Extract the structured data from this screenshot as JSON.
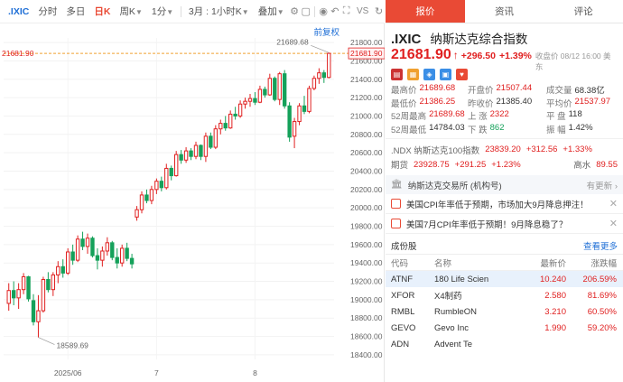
{
  "toolbar": {
    "code": ".IXIC",
    "items": [
      "分时",
      "多日",
      "日K",
      "周K",
      "1分",
      "3月",
      "1小时K",
      "叠加"
    ],
    "vs": "VS"
  },
  "chart": {
    "restore_label": "前复权",
    "current_price_label": "21681.90",
    "high_label": "21689.68",
    "low_label": "18589.69",
    "colors": {
      "up": "#e02020",
      "down": "#15a15a",
      "price_line": "#f0a030"
    }
  },
  "chart_data": {
    "type": "candlestick",
    "x_labels": [
      "2025/06",
      "7",
      "8"
    ],
    "y_ticks": [
      21800,
      21600,
      21400,
      21200,
      21000,
      20800,
      20600,
      20400,
      20200,
      20000,
      19800,
      19600,
      19400,
      19200,
      19000,
      18800,
      18600,
      18400
    ],
    "ylim": [
      18350,
      21850
    ],
    "candles": [
      {
        "o": 18960,
        "h": 19180,
        "l": 18880,
        "c": 19100
      },
      {
        "o": 19100,
        "h": 19200,
        "l": 18940,
        "c": 19020
      },
      {
        "o": 19020,
        "h": 19180,
        "l": 18900,
        "c": 19110
      },
      {
        "o": 19110,
        "h": 19290,
        "l": 19060,
        "c": 19250
      },
      {
        "o": 19250,
        "h": 19260,
        "l": 18980,
        "c": 19010
      },
      {
        "o": 18990,
        "h": 19060,
        "l": 18720,
        "c": 18760
      },
      {
        "o": 18760,
        "h": 19050,
        "l": 18590,
        "c": 18880
      },
      {
        "o": 18880,
        "h": 19250,
        "l": 18860,
        "c": 19220
      },
      {
        "o": 19220,
        "h": 19300,
        "l": 19080,
        "c": 19110
      },
      {
        "o": 19110,
        "h": 19300,
        "l": 19040,
        "c": 19270
      },
      {
        "o": 19270,
        "h": 19420,
        "l": 19180,
        "c": 19360
      },
      {
        "o": 19360,
        "h": 19440,
        "l": 19240,
        "c": 19290
      },
      {
        "o": 19290,
        "h": 19560,
        "l": 19270,
        "c": 19520
      },
      {
        "o": 19520,
        "h": 19600,
        "l": 19380,
        "c": 19430
      },
      {
        "o": 19430,
        "h": 19700,
        "l": 19410,
        "c": 19660
      },
      {
        "o": 19660,
        "h": 19740,
        "l": 19540,
        "c": 19580
      },
      {
        "o": 19580,
        "h": 19720,
        "l": 19500,
        "c": 19670
      },
      {
        "o": 19670,
        "h": 19690,
        "l": 19460,
        "c": 19480
      },
      {
        "o": 19480,
        "h": 19560,
        "l": 19330,
        "c": 19430
      },
      {
        "o": 19430,
        "h": 19580,
        "l": 19360,
        "c": 19530
      },
      {
        "o": 19530,
        "h": 19680,
        "l": 19480,
        "c": 19620
      },
      {
        "o": 19620,
        "h": 19640,
        "l": 19430,
        "c": 19460
      },
      {
        "o": 19460,
        "h": 19560,
        "l": 19340,
        "c": 19400
      },
      {
        "o": 19400,
        "h": 19600,
        "l": 19360,
        "c": 19560
      },
      {
        "o": 19560,
        "h": 19620,
        "l": 19420,
        "c": 19450
      },
      {
        "o": 19450,
        "h": 19500,
        "l": 19340,
        "c": 19390
      },
      {
        "o": 19900,
        "h": 20020,
        "l": 19860,
        "c": 19980
      },
      {
        "o": 19980,
        "h": 20180,
        "l": 19940,
        "c": 20140
      },
      {
        "o": 20140,
        "h": 20200,
        "l": 20050,
        "c": 20080
      },
      {
        "o": 20080,
        "h": 20240,
        "l": 20040,
        "c": 20200
      },
      {
        "o": 20200,
        "h": 20320,
        "l": 20150,
        "c": 20290
      },
      {
        "o": 20290,
        "h": 20340,
        "l": 20180,
        "c": 20220
      },
      {
        "o": 20220,
        "h": 20480,
        "l": 20200,
        "c": 20430
      },
      {
        "o": 20430,
        "h": 20460,
        "l": 20300,
        "c": 20350
      },
      {
        "o": 20350,
        "h": 20620,
        "l": 20340,
        "c": 20580
      },
      {
        "o": 20580,
        "h": 20630,
        "l": 20480,
        "c": 20520
      },
      {
        "o": 20520,
        "h": 20660,
        "l": 20490,
        "c": 20620
      },
      {
        "o": 20620,
        "h": 20650,
        "l": 20520,
        "c": 20560
      },
      {
        "o": 20560,
        "h": 20720,
        "l": 20530,
        "c": 20680
      },
      {
        "o": 20680,
        "h": 20690,
        "l": 20520,
        "c": 20560
      },
      {
        "o": 20560,
        "h": 20820,
        "l": 20500,
        "c": 20780
      },
      {
        "o": 20780,
        "h": 20820,
        "l": 20640,
        "c": 20660
      },
      {
        "o": 20660,
        "h": 20900,
        "l": 20640,
        "c": 20860
      },
      {
        "o": 20860,
        "h": 20960,
        "l": 20800,
        "c": 20920
      },
      {
        "o": 20920,
        "h": 21000,
        "l": 20840,
        "c": 20870
      },
      {
        "o": 20870,
        "h": 21060,
        "l": 20860,
        "c": 21020
      },
      {
        "o": 21020,
        "h": 21100,
        "l": 20960,
        "c": 21000
      },
      {
        "o": 21000,
        "h": 21170,
        "l": 20980,
        "c": 21130
      },
      {
        "o": 21130,
        "h": 21200,
        "l": 21080,
        "c": 21160
      },
      {
        "o": 21160,
        "h": 21240,
        "l": 21100,
        "c": 21190
      },
      {
        "o": 21190,
        "h": 21260,
        "l": 21120,
        "c": 21150
      },
      {
        "o": 21150,
        "h": 21330,
        "l": 21140,
        "c": 21290
      },
      {
        "o": 21290,
        "h": 21320,
        "l": 21200,
        "c": 21230
      },
      {
        "o": 21230,
        "h": 21460,
        "l": 21220,
        "c": 21410
      },
      {
        "o": 21410,
        "h": 21430,
        "l": 21160,
        "c": 21180
      },
      {
        "o": 21180,
        "h": 21480,
        "l": 21120,
        "c": 21460
      },
      {
        "o": 21460,
        "h": 21500,
        "l": 21080,
        "c": 21110
      },
      {
        "o": 21110,
        "h": 21150,
        "l": 20720,
        "c": 20770
      },
      {
        "o": 20780,
        "h": 20980,
        "l": 20650,
        "c": 20940
      },
      {
        "o": 20940,
        "h": 21140,
        "l": 20900,
        "c": 21110
      },
      {
        "o": 21110,
        "h": 21220,
        "l": 21020,
        "c": 21050
      },
      {
        "o": 21050,
        "h": 21330,
        "l": 21030,
        "c": 21300
      },
      {
        "o": 21300,
        "h": 21440,
        "l": 21280,
        "c": 21410
      },
      {
        "o": 21410,
        "h": 21520,
        "l": 21350,
        "c": 21470
      },
      {
        "o": 21470,
        "h": 21500,
        "l": 21360,
        "c": 21420
      },
      {
        "o": 21420,
        "h": 21689.68,
        "l": 21410,
        "c": 21681.9
      }
    ]
  },
  "right": {
    "tabs": [
      "报价",
      "资讯",
      "评论"
    ],
    "ticker": ".IXIC",
    "name": "纳斯达克综合指数",
    "price": "21681.90",
    "change": "+296.50",
    "change_pct": "+1.39%",
    "stamp": "收盘价 08/12 16:00 美东",
    "stats": [
      [
        {
          "l": "最高价",
          "v": "21689.68",
          "c": "red"
        },
        {
          "l": "开盘价",
          "v": "21507.44",
          "c": "red"
        },
        {
          "l": "成交量",
          "v": "68.38亿",
          "c": ""
        }
      ],
      [
        {
          "l": "最低价",
          "v": "21386.25",
          "c": "red"
        },
        {
          "l": "昨收价",
          "v": "21385.40",
          "c": ""
        },
        {
          "l": "平均价",
          "v": "21537.97",
          "c": "red"
        }
      ],
      [
        {
          "l": "52周最高",
          "v": "21689.68",
          "c": "red"
        },
        {
          "l": "上 涨",
          "v": "2322",
          "c": "red"
        },
        {
          "l": "平 盘",
          "v": "118",
          "c": ""
        }
      ],
      [
        {
          "l": "52周最低",
          "v": "14784.03",
          "c": ""
        },
        {
          "l": "下 跌",
          "v": "862",
          "c": "green"
        },
        {
          "l": "振 幅",
          "v": "1.42%",
          "c": ""
        }
      ]
    ],
    "ndx": {
      "label": ".NDX 纳斯达克100指数",
      "price": "23839.20",
      "chg": "+312.56",
      "pct": "+1.33%"
    },
    "futures": {
      "label": "期货",
      "price": "23928.75",
      "chg": "+291.25",
      "pct": "+1.23%",
      "extra_label": "高水",
      "extra_val": "89.55"
    },
    "exchange": {
      "label": "纳斯达克交易所 (机构号)",
      "more": "有更新"
    },
    "news": [
      "美国CPI年率低于预期，市场加大9月降息押注！",
      "美国7月CPI年率低于预期！9月降息稳了？"
    ],
    "components": {
      "title": "成份股",
      "more": "查看更多",
      "headers": [
        "代码",
        "名称",
        "最新价",
        "涨跌幅"
      ],
      "rows": [
        {
          "code": "ATNF",
          "name": "180 Life Scien",
          "price": "10.240",
          "pct": "206.59%"
        },
        {
          "code": "XFOR",
          "name": "X4制药",
          "price": "2.580",
          "pct": "81.69%"
        },
        {
          "code": "RMBL",
          "name": "RumbleON",
          "price": "3.210",
          "pct": "60.50%"
        },
        {
          "code": "GEVO",
          "name": "Gevo Inc",
          "price": "1.990",
          "pct": "59.20%"
        },
        {
          "code": "ADN",
          "name": "Advent Te",
          "price": "",
          "pct": ""
        }
      ]
    }
  }
}
